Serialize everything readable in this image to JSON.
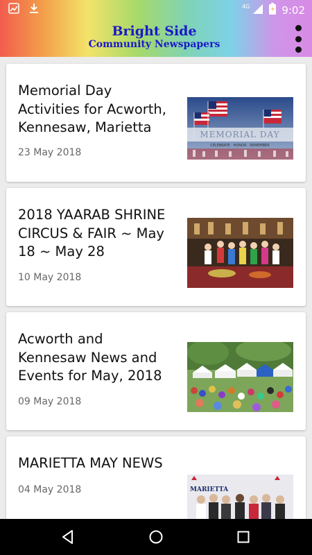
{
  "status_bar": {
    "time": "9:02",
    "network": "4G",
    "icons": [
      "app-notification-icon",
      "download-icon",
      "signal-icon",
      "battery-icon"
    ]
  },
  "header": {
    "title": "Bright Side",
    "subtitle": "Community Newspapers",
    "menu_icon": "more-vert-icon"
  },
  "articles": [
    {
      "title": "Memorial Day Activities for Acworth, Kennesaw, Marietta",
      "date": "23 May 2018",
      "thumb_text": "MEMORIAL DAY",
      "thumb_subtext": "CELEBRATE · HONOR · REMEMBER"
    },
    {
      "title": "2018 YAARAB SHRINE CIRCUS & FAIR ~ May 18 ~ May 28",
      "date": "10 May 2018"
    },
    {
      "title": "Acworth and Kennesaw News and Events for May, 2018",
      "date": "09 May 2018"
    },
    {
      "title": "MARIETTA MAY NEWS",
      "date": "04 May 2018",
      "thumb_text": "MARIETTA"
    }
  ],
  "nav": {
    "back": "back-icon",
    "home": "home-icon",
    "recents": "recents-icon"
  },
  "colors": {
    "brand_text": "#1a18c8",
    "card_bg": "#ffffff",
    "page_bg": "#ececec",
    "nav_bg": "#000000"
  }
}
